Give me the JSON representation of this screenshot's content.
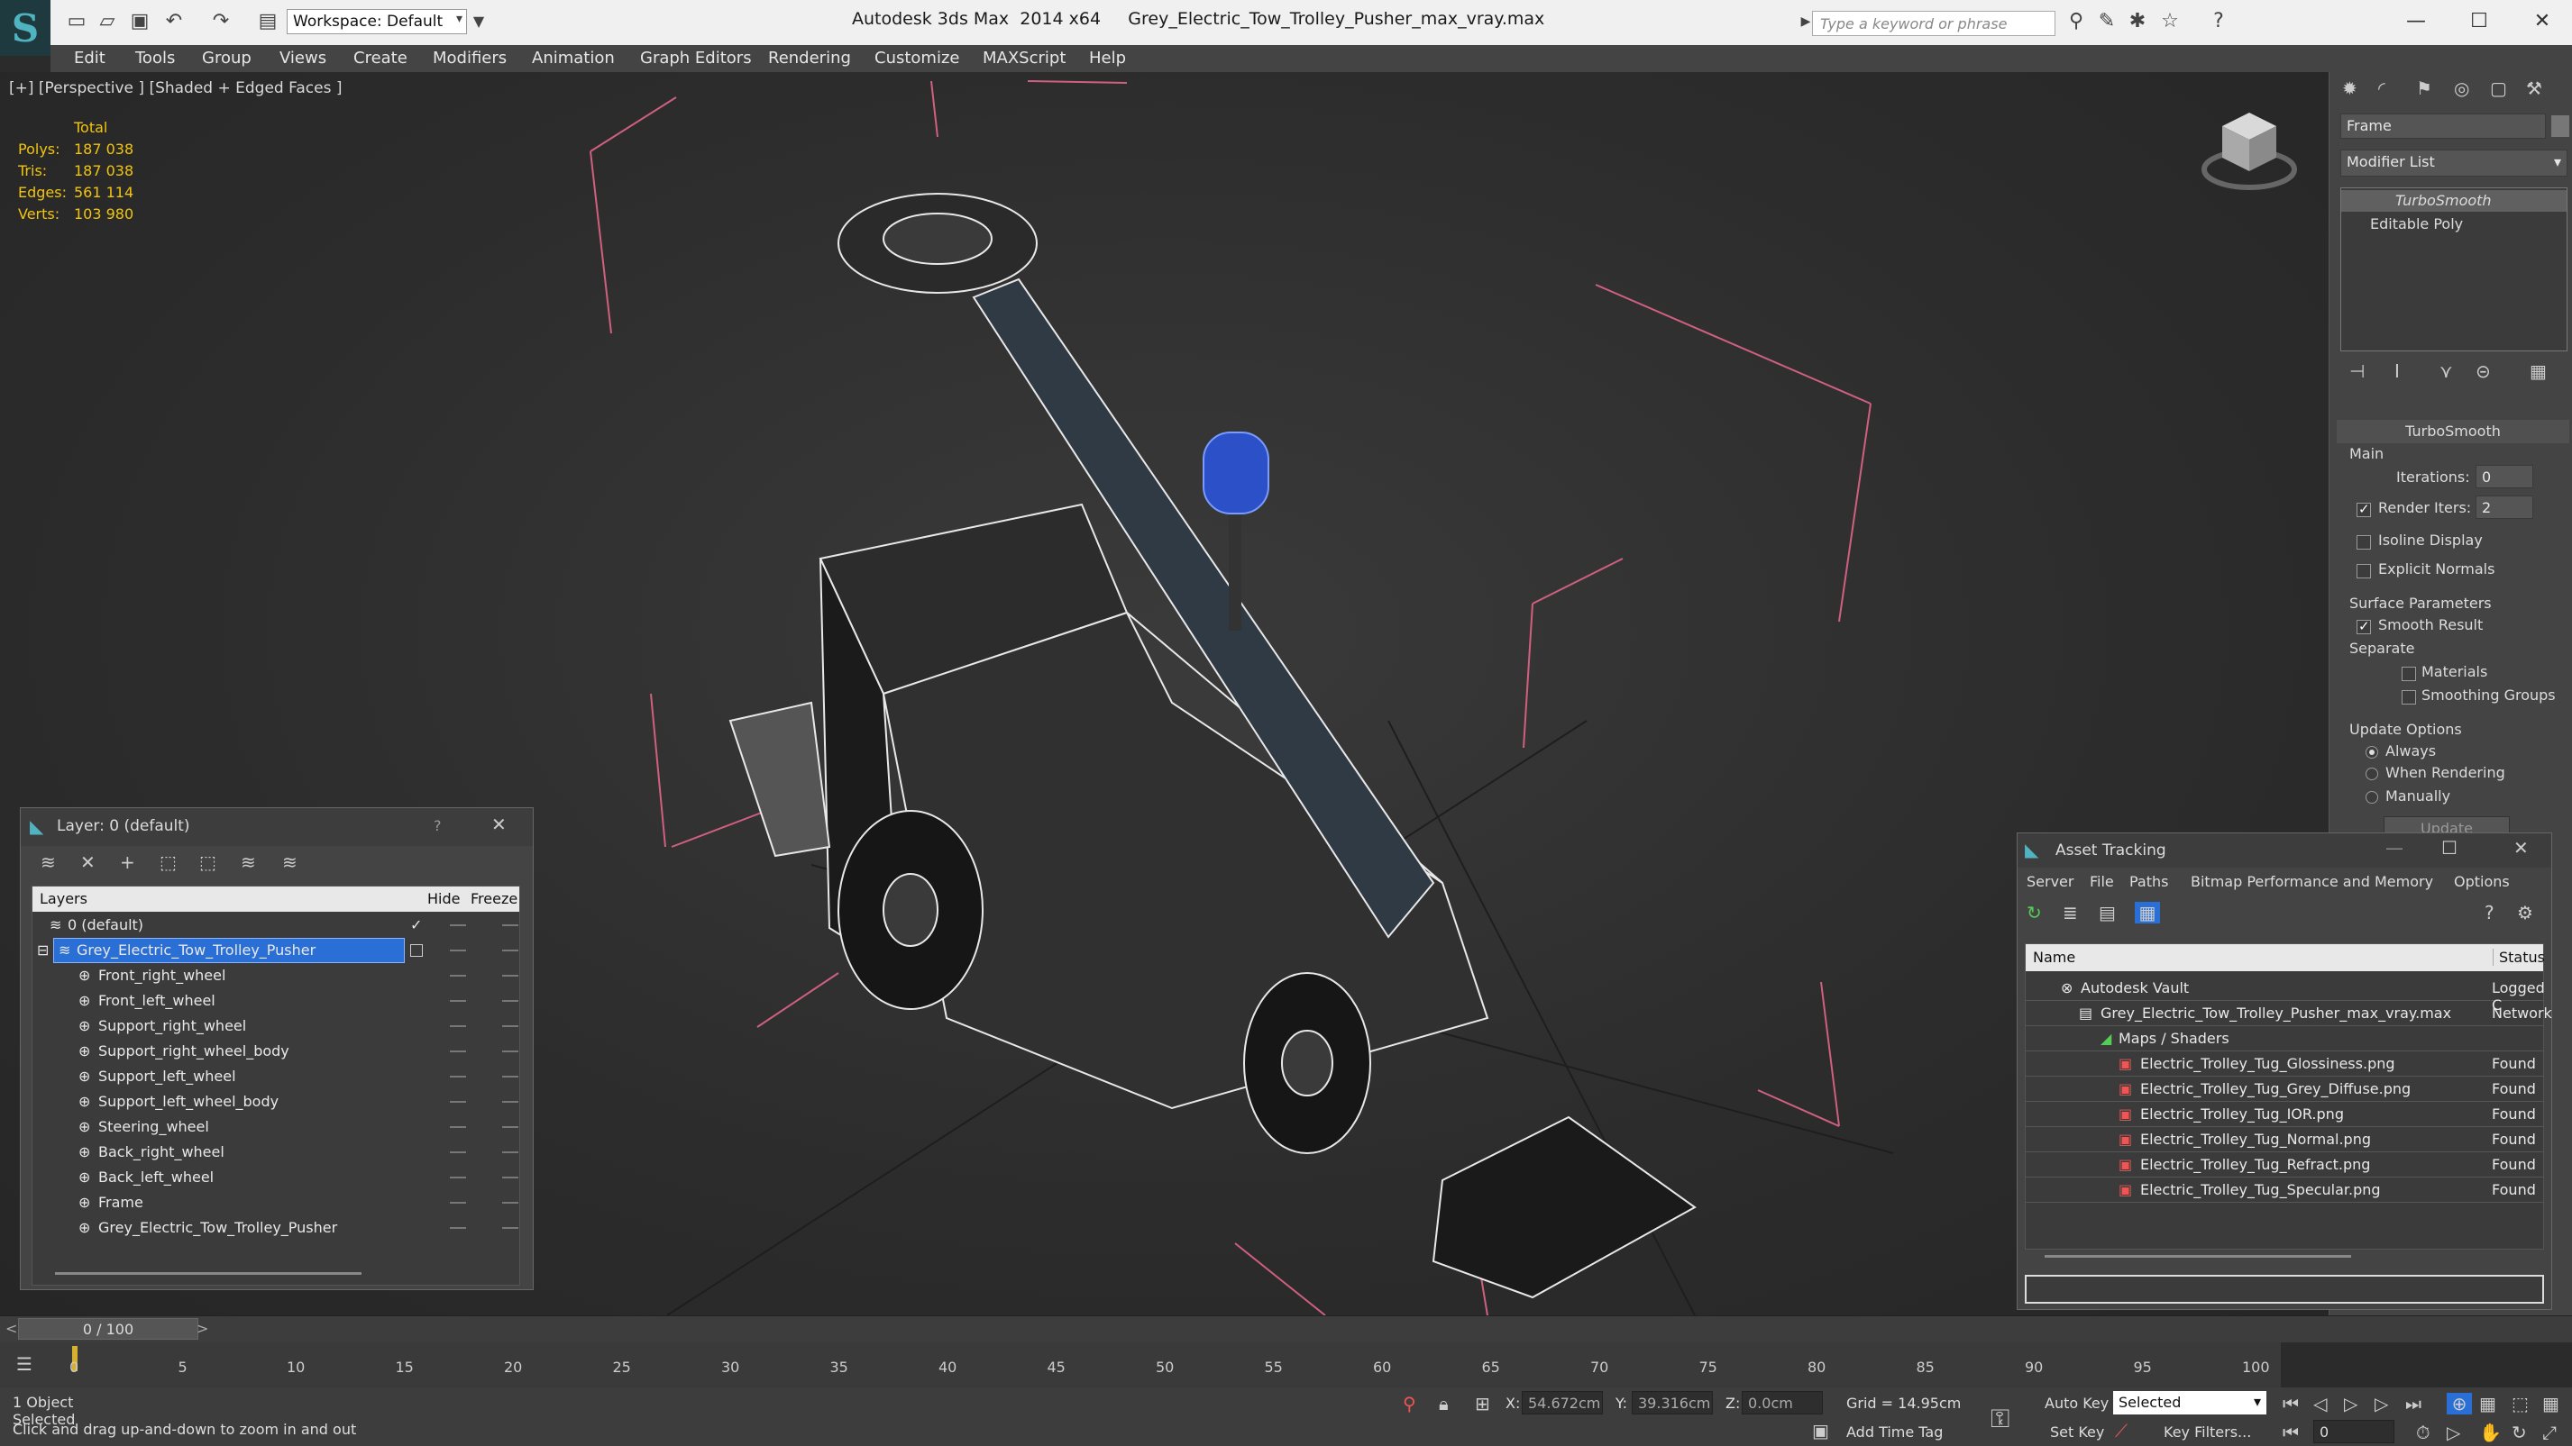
{
  "app": {
    "title": "Autodesk 3ds Max  2014 x64     Grey_Electric_Tow_Trolley_Pusher_max_vray.max",
    "workspace_label": "Workspace: Default",
    "search_placeholder": "Type a keyword or phrase"
  },
  "menu": [
    "Edit",
    "Tools",
    "Group",
    "Views",
    "Create",
    "Modifiers",
    "Animation",
    "Graph Editors",
    "Rendering",
    "Customize",
    "MAXScript",
    "Help"
  ],
  "viewport": {
    "label": "[+] [Perspective ] [Shaded + Edged Faces ]",
    "stats": {
      "header": "Total",
      "polys_label": "Polys:",
      "polys": "187 038",
      "tris_label": "Tris:",
      "tris": "187 038",
      "edges_label": "Edges:",
      "edges": "561 114",
      "verts_label": "Verts:",
      "verts": "103 980"
    }
  },
  "command_panel": {
    "object_name": "Frame",
    "modifier_list_label": "Modifier List",
    "stack": [
      "TurboSmooth",
      "Editable Poly"
    ],
    "rollout_title": "TurboSmooth",
    "main_label": "Main",
    "iterations_label": "Iterations:",
    "iterations": "0",
    "render_iters_label": "Render Iters:",
    "render_iters": "2",
    "isoline_label": "Isoline Display",
    "explicit_normals_label": "Explicit Normals",
    "surface_params_label": "Surface Parameters",
    "smooth_result_label": "Smooth Result",
    "separate_label": "Separate",
    "materials_label": "Materials",
    "smoothing_groups_label": "Smoothing Groups",
    "update_options_label": "Update Options",
    "always_label": "Always",
    "when_rendering_label": "When Rendering",
    "manually_label": "Manually",
    "update_button": "Update"
  },
  "layer_dialog": {
    "title": "Layer: 0 (default)",
    "help": "?",
    "col_layers": "Layers",
    "col_hide": "Hide",
    "col_freeze": "Freeze",
    "rows": [
      "0 (default)",
      "Grey_Electric_Tow_Trolley_Pusher",
      "Front_right_wheel",
      "Front_left_wheel",
      "Support_right_wheel",
      "Support_right_wheel_body",
      "Support_left_wheel",
      "Support_left_wheel_body",
      "Steering_wheel",
      "Back_right_wheel",
      "Back_left_wheel",
      "Frame",
      "Grey_Electric_Tow_Trolley_Pusher"
    ]
  },
  "asset_dialog": {
    "title": "Asset Tracking",
    "menu": [
      "Server",
      "File",
      "Paths",
      "Bitmap Performance and Memory",
      "Options"
    ],
    "col_name": "Name",
    "col_status": "Status",
    "rows": [
      {
        "name": "Autodesk Vault",
        "status": "Logged C"
      },
      {
        "name": "Grey_Electric_Tow_Trolley_Pusher_max_vray.max",
        "status": "Network"
      },
      {
        "name": "Maps / Shaders",
        "status": ""
      },
      {
        "name": "Electric_Trolley_Tug_Glossiness.png",
        "status": "Found"
      },
      {
        "name": "Electric_Trolley_Tug_Grey_Diffuse.png",
        "status": "Found"
      },
      {
        "name": "Electric_Trolley_Tug_IOR.png",
        "status": "Found"
      },
      {
        "name": "Electric_Trolley_Tug_Normal.png",
        "status": "Found"
      },
      {
        "name": "Electric_Trolley_Tug_Refract.png",
        "status": "Found"
      },
      {
        "name": "Electric_Trolley_Tug_Specular.png",
        "status": "Found"
      }
    ]
  },
  "timeline": {
    "frame_counter": "0 / 100",
    "ticks": [
      "0",
      "5",
      "10",
      "15",
      "20",
      "25",
      "30",
      "35",
      "40",
      "45",
      "50",
      "55",
      "60",
      "65",
      "70",
      "75",
      "80",
      "85",
      "90",
      "95",
      "100"
    ]
  },
  "status": {
    "selection": "1 Object Selected",
    "prompt": "Click and drag up-and-down to zoom in and out",
    "x_label": "X:",
    "x": "54.672cm",
    "y_label": "Y:",
    "y": "39.316cm",
    "z_label": "Z:",
    "z": "0.0cm",
    "grid": "Grid = 14.95cm",
    "add_time_tag": "Add Time Tag",
    "auto_key": "Auto Key",
    "set_key": "Set Key",
    "selected_option": "Selected",
    "key_filters": "Key Filters...",
    "current_frame": "0"
  }
}
